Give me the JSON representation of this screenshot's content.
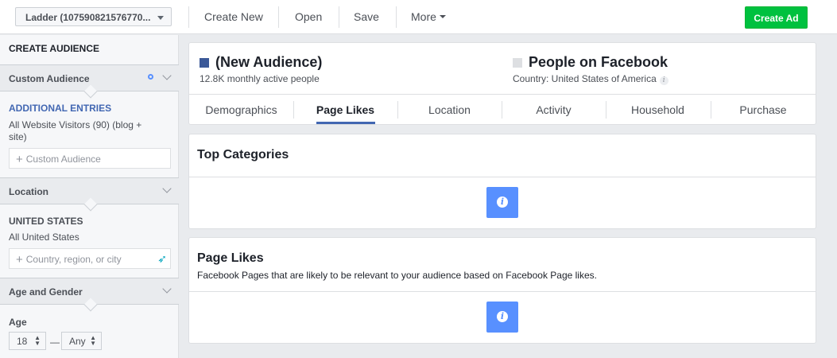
{
  "topbar": {
    "account_label": "Ladder (107590821576770...",
    "create_new": "Create New",
    "open": "Open",
    "save": "Save",
    "more": "More",
    "create_ad": "Create Ad"
  },
  "sidebar": {
    "title": "CREATE AUDIENCE",
    "custom_audience": {
      "header": "Custom Audience",
      "sub_title": "ADDITIONAL ENTRIES",
      "entry": "All Website Visitors (90) (blog + site)",
      "placeholder": "Custom Audience"
    },
    "location": {
      "header": "Location",
      "sub_title": "UNITED STATES",
      "entry": "All United States",
      "placeholder": "Country, region, or city"
    },
    "age_gender": {
      "header": "Age and Gender",
      "age_label": "Age",
      "age_min": "18",
      "dash": "—",
      "age_max": "Any"
    }
  },
  "audience_card": {
    "new_audience": {
      "name": "(New Audience)",
      "subtitle": "12.8K monthly active people",
      "color": "#3b5998"
    },
    "people_on_facebook": {
      "name": "People on Facebook",
      "subtitle": "Country: United States of America",
      "color": "#dddfe2"
    },
    "tabs": [
      "Demographics",
      "Page Likes",
      "Location",
      "Activity",
      "Household",
      "Purchase"
    ],
    "selected_tab": "Page Likes"
  },
  "top_categories": {
    "title": "Top Categories"
  },
  "page_likes": {
    "title": "Page Likes",
    "description": "Facebook Pages that are likely to be relevant to your audience based on Facebook Page likes."
  },
  "colors": {
    "accent": "#4267b2",
    "info_button": "#5890ff",
    "create_ad_button": "#00c13f"
  }
}
